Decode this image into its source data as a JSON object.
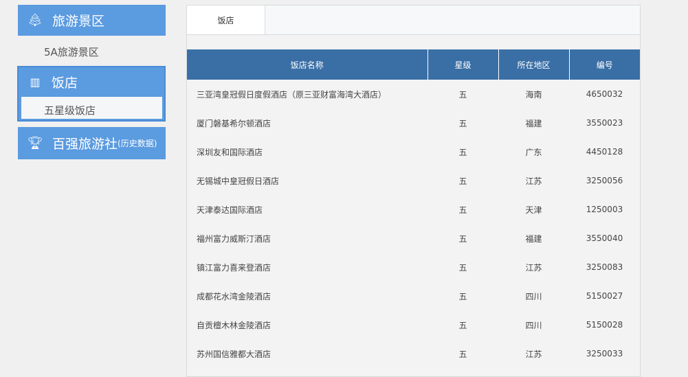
{
  "sidebar": {
    "scenic": {
      "label": "旅游景区",
      "icon": "tree-icon",
      "sub": "5A旅游景区"
    },
    "hotel": {
      "label": "饭店",
      "icon": "buildings-icon",
      "sub": "五星级饭店"
    },
    "agency": {
      "label": "百强旅游社",
      "suffix": "(历史数据)",
      "icon": "trophy-icon"
    }
  },
  "tabs": [
    "饭店"
  ],
  "table": {
    "headers": [
      "饭店名称",
      "星级",
      "所在地区",
      "编号"
    ],
    "rows": [
      [
        "三亚湾皇冠假日度假酒店（原三亚财富海湾大酒店）",
        "五",
        "海南",
        "4650032"
      ],
      [
        "厦门磐基希尔顿酒店",
        "五",
        "福建",
        "3550023"
      ],
      [
        "深圳友和国际酒店",
        "五",
        "广东",
        "4450128"
      ],
      [
        "无锡城中皇冠假日酒店",
        "五",
        "江苏",
        "3250056"
      ],
      [
        "天津泰达国际酒店",
        "五",
        "天津",
        "1250003"
      ],
      [
        "福州富力威斯汀酒店",
        "五",
        "福建",
        "3550040"
      ],
      [
        "镇江富力喜来登酒店",
        "五",
        "江苏",
        "3250083"
      ],
      [
        "成都花水湾金陵酒店",
        "五",
        "四川",
        "5150027"
      ],
      [
        "自贡檀木林金陵酒店",
        "五",
        "四川",
        "5150028"
      ],
      [
        "苏州国信雅都大酒店",
        "五",
        "江苏",
        "3250033"
      ]
    ]
  }
}
